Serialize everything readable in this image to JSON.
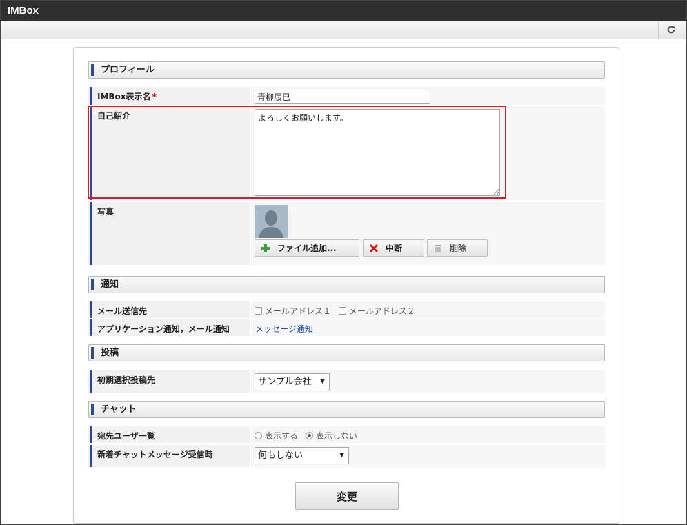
{
  "app": {
    "title": "IMBox"
  },
  "sections": {
    "profile": "プロフィール",
    "notification": "通知",
    "post": "投稿",
    "chat": "チャット"
  },
  "profile": {
    "display_name_label": "IMBox表示名",
    "required_mark": "*",
    "display_name_value": "青柳辰巳",
    "intro_label": "自己紹介",
    "intro_value": "よろしくお願いします。",
    "photo_label": "写真",
    "add_file_label": "ファイル追加...",
    "abort_label": "中断",
    "delete_label": "削除"
  },
  "notification": {
    "mail_label": "メール送信先",
    "mail_option_1": "メールアドレス１",
    "mail_option_2": "メールアドレス２",
    "app_mail_label": "アプリケーション通知，メール通知",
    "message_link": "メッセージ通知"
  },
  "post": {
    "default_target_label": "初期選択投稿先",
    "default_target_value": "サンプル会社"
  },
  "chat": {
    "recipient_list_label": "宛先ユーザ一覧",
    "radio_show": "表示する",
    "radio_hide": "表示しない",
    "new_message_label": "新着チャットメッセージ受信時",
    "new_message_value": "何もしない"
  },
  "submit_label": "変更",
  "colors": {
    "accent": "#2b4d8f",
    "highlight": "#e0162b",
    "link": "#1f4fa8"
  }
}
